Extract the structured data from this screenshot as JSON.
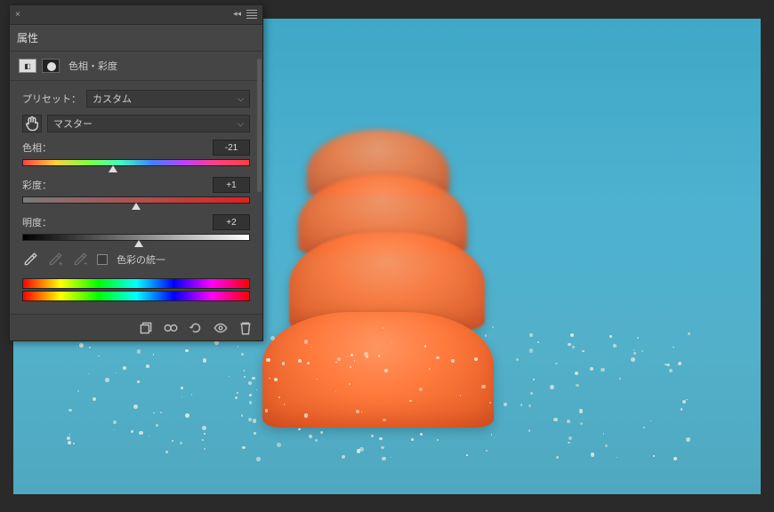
{
  "panel": {
    "title": "属性",
    "adjustmentName": "色相・彩度",
    "presetLabel": "プリセット：",
    "presetValue": "カスタム",
    "channelValue": "マスター",
    "hue": {
      "label": "色相：",
      "value": "-21",
      "thumbPercent": 40
    },
    "saturation": {
      "label": "彩度：",
      "value": "+1",
      "thumbPercent": 50
    },
    "lightness": {
      "label": "明度：",
      "value": "+2",
      "thumbPercent": 51
    },
    "colorizeLabel": "色彩の統一"
  }
}
